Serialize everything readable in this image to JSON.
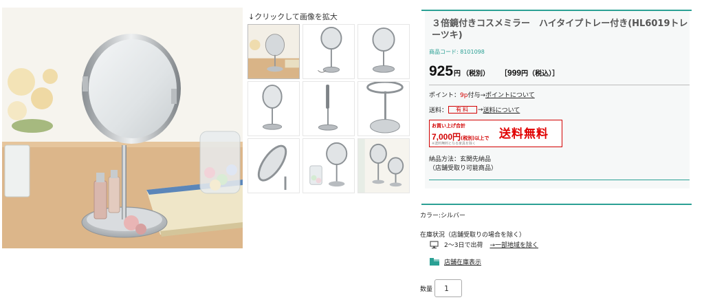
{
  "gallery": {
    "zoom_hint": "↓クリックして画像を拡大",
    "thumbnail_count": 9
  },
  "product": {
    "title": "３倍鏡付きコスメミラー　ハイタイプトレー付き(HL6019トレーツキ)",
    "code": "商品コード: 8101098",
    "price": "925",
    "price_yen": "円",
    "price_tax_note": "（税別）",
    "price_taxin_open": "［",
    "price_taxin_value": "999",
    "price_taxin_unit": "円（税込）",
    "price_taxin_close": "］"
  },
  "points": {
    "label": "ポイント：",
    "value": "9p",
    "suffix": "付与→",
    "link": "ポイントについて"
  },
  "shipping": {
    "label": "送料：",
    "badge": "有料",
    "arrow": "→",
    "link": "送料について"
  },
  "free_shipping_banner": {
    "line1": "お買い上げ合計",
    "amount": "7,000円",
    "tax_note": "(税別)",
    "suffix": "以上で",
    "free_text": "送料無料",
    "note": "※送料無料となる家具を除く"
  },
  "delivery": {
    "line1": "納品方法：玄関先納品",
    "line2": "（店舗受取り可能商品）"
  },
  "color": {
    "label": "カラー:シルバー"
  },
  "stock": {
    "title": "在庫状況（店舗受取りの場合を除く）",
    "ship_text": "2〜3日で出荷",
    "region_link": "→一部地域を除く",
    "store_link": "店舗在庫表示"
  },
  "quantity": {
    "label": "数量",
    "value": "1"
  },
  "colors": {
    "accent": "#2aa094",
    "price_red": "#d20000",
    "panel_bg": "#f6f8f8"
  }
}
